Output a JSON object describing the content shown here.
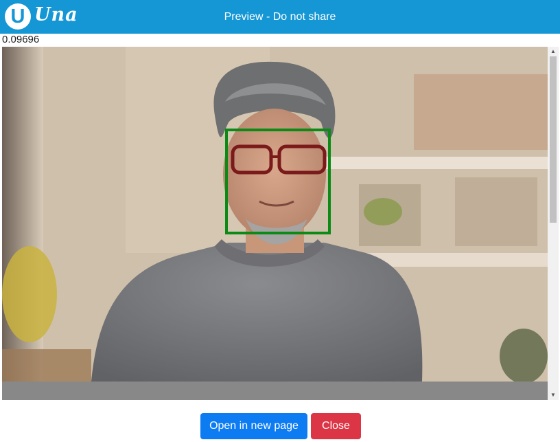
{
  "header": {
    "logo_letter": "U",
    "logo_text": "Una",
    "title": "Preview - Do not share",
    "background_color": "#1597d5"
  },
  "preview": {
    "score": "0.09696",
    "image_description_icon": "photo-image",
    "face_box_color": "#0b8a16"
  },
  "actions": {
    "open_label": "Open in new page",
    "close_label": "Close",
    "open_color": "#0d7cf2",
    "close_color": "#dc3545"
  }
}
